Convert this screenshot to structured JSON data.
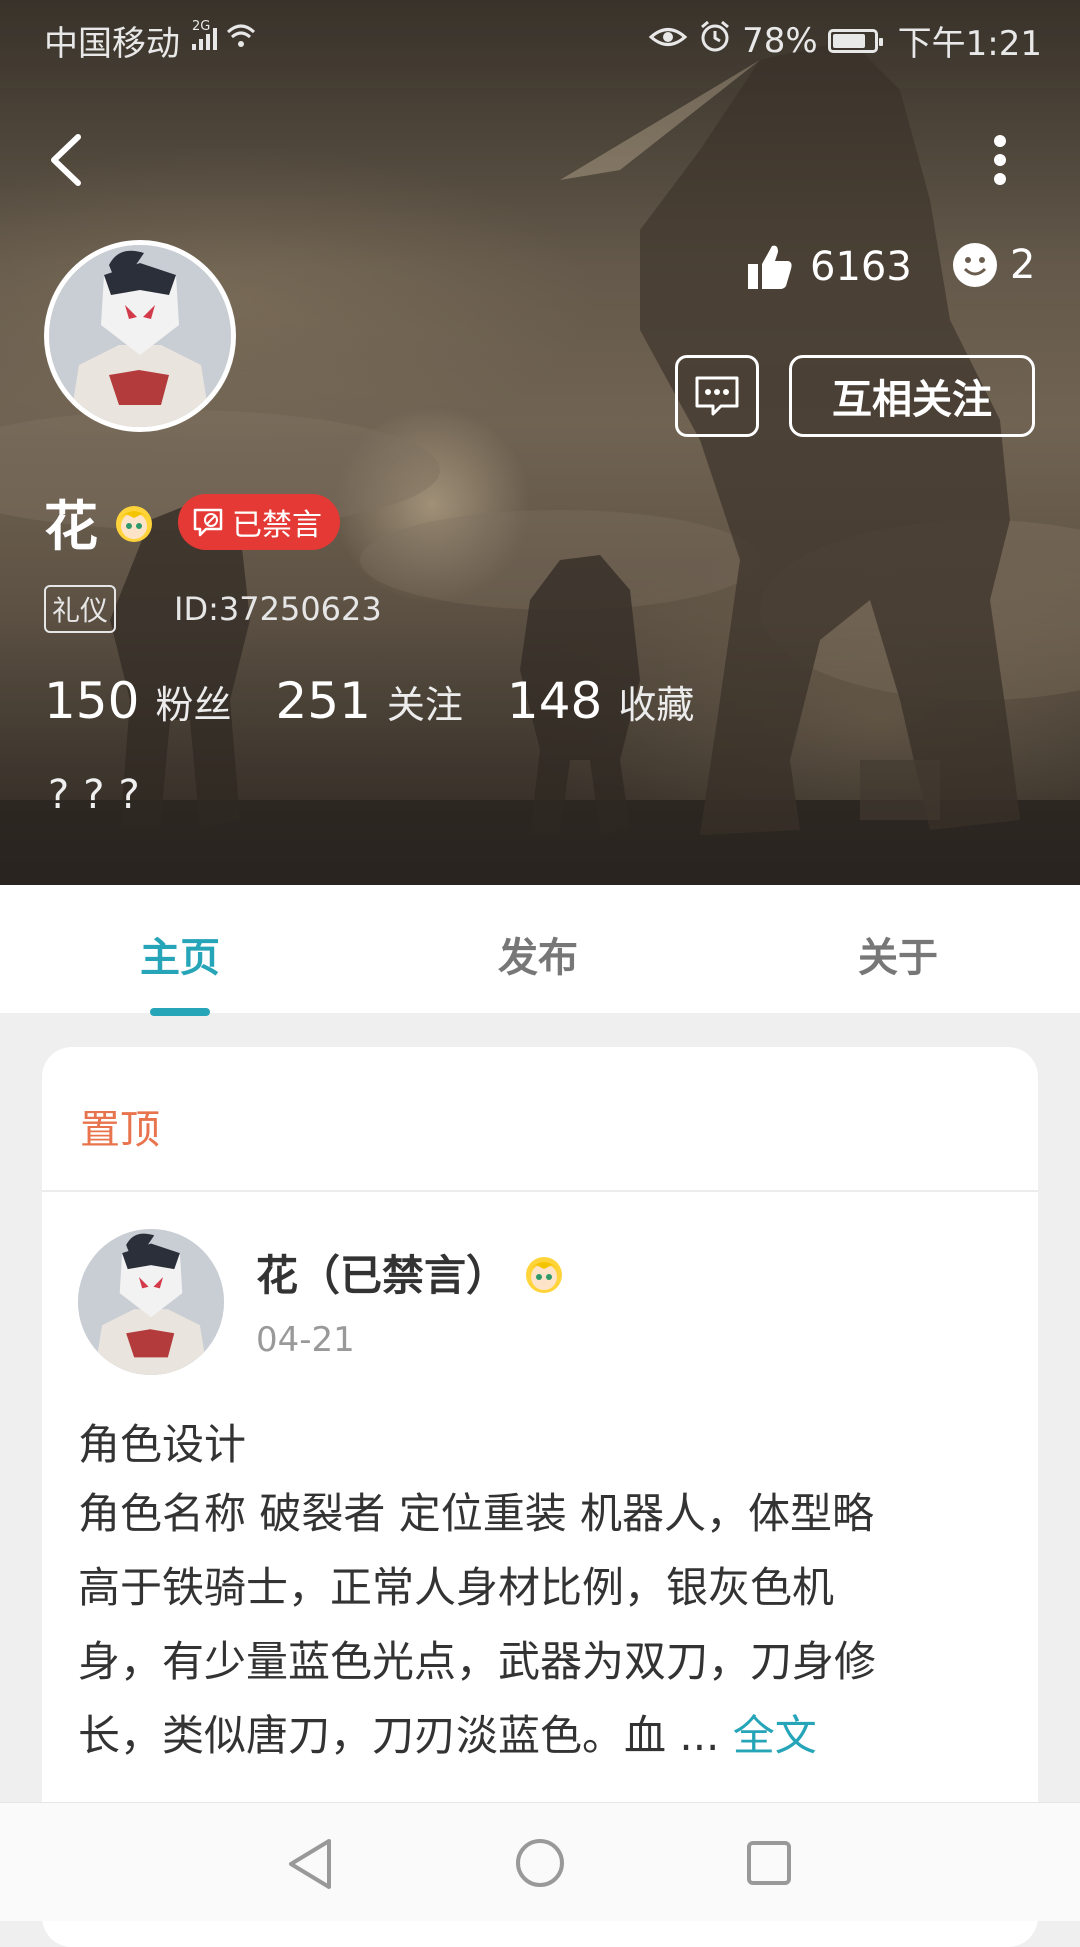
{
  "status_bar": {
    "carrier": "中国移动",
    "network": "2G",
    "battery": "78%",
    "time": "下午1:21"
  },
  "profile": {
    "likes": "6163",
    "reactions": "2",
    "follow_button": "互相关注",
    "name": "花",
    "banned_badge": "已禁言",
    "tag": "礼仪",
    "id": "ID:37250623",
    "fans_count": "150",
    "fans_label": "粉丝",
    "following_count": "251",
    "following_label": "关注",
    "favorites_count": "148",
    "favorites_label": "收藏",
    "bio": "???"
  },
  "tabs": [
    {
      "label": "主页",
      "active": true
    },
    {
      "label": "发布",
      "active": false
    },
    {
      "label": "关于",
      "active": false
    }
  ],
  "pinned_post": {
    "section_label": "置顶",
    "author": "花（已禁言）",
    "date": "04-21",
    "title": "角色设计",
    "body_lines": [
      "角色名称 破裂者 定位重装 机器人，体型略",
      "高于铁骑士，正常人身材比例，银灰色机",
      "身，有少量蓝色光点，武器为双刀，刀身修",
      "长，类似唐刀，刀刃淡蓝色。血 ..."
    ],
    "more_link": "全文"
  },
  "colors": {
    "accent": "#26a4b8",
    "banned": "#e53935",
    "pinned": "#e8744d"
  }
}
